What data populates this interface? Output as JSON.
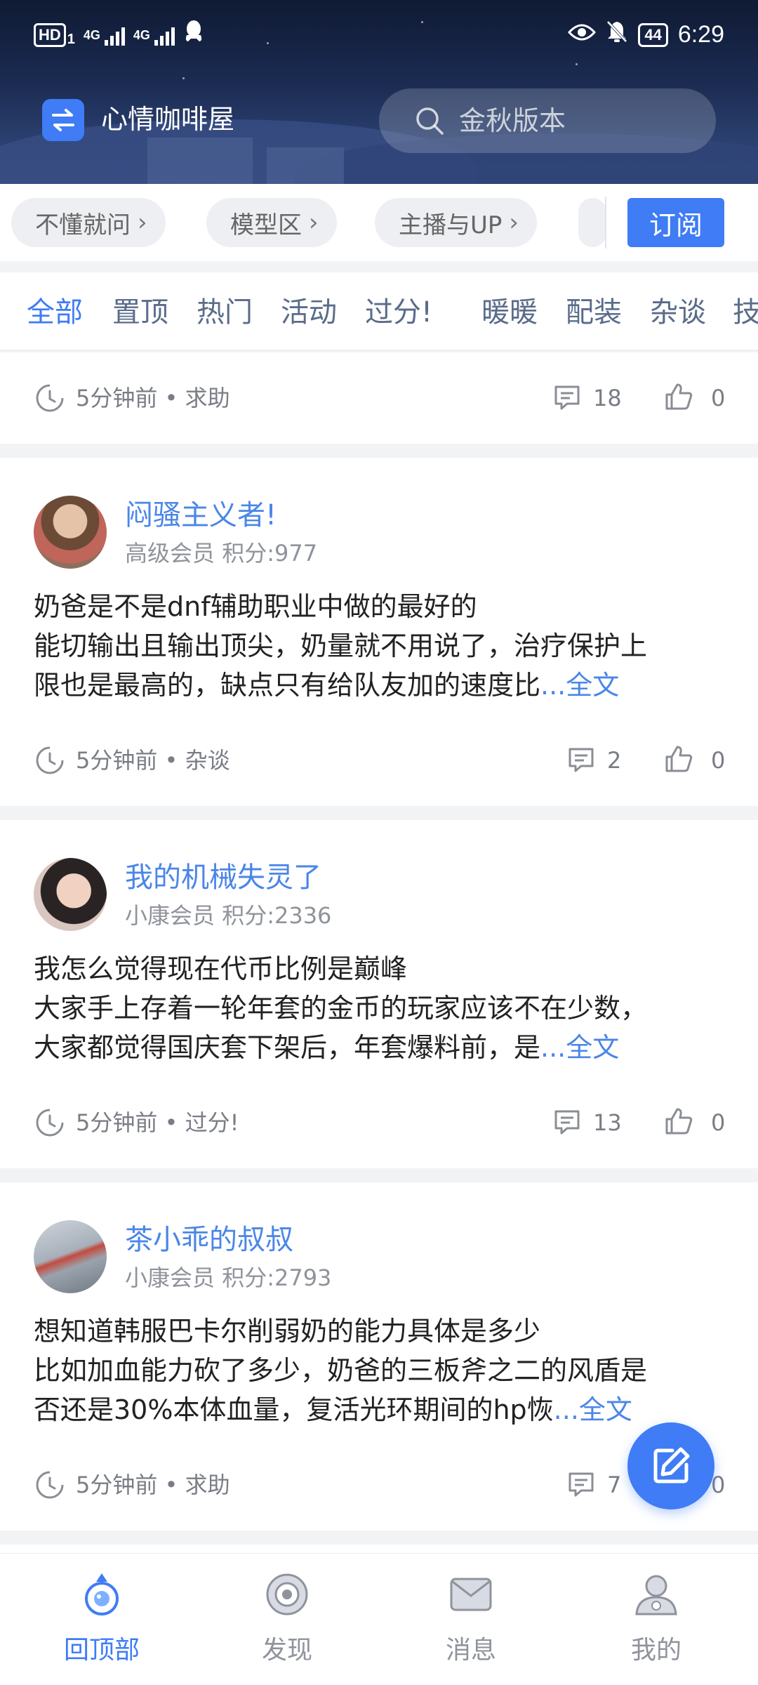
{
  "status_bar": {
    "hd": "HD",
    "sim_slot": "1",
    "net1": "4G",
    "net2": "4G",
    "battery": "44",
    "time": "6:29"
  },
  "header": {
    "title": "心情咖啡屋",
    "search_placeholder": "金秋版本"
  },
  "chips": [
    {
      "label": "不懂就问"
    },
    {
      "label": "模型区"
    },
    {
      "label": "主播与UP"
    }
  ],
  "subscribe_label": "订阅",
  "tabs": [
    {
      "label": "全部",
      "active": true
    },
    {
      "label": "置顶"
    },
    {
      "label": "热门"
    },
    {
      "label": "活动"
    },
    {
      "label": "过分!"
    },
    {
      "label": "暖暖"
    },
    {
      "label": "配装"
    },
    {
      "label": "杂谈"
    },
    {
      "label": "技"
    }
  ],
  "top_meta": {
    "time": "5分钟前",
    "category": "求助",
    "comments": "18",
    "likes": "0"
  },
  "posts": [
    {
      "user": "闷骚主义者!",
      "level": "高级会员",
      "score_label": "积分:977",
      "title": "奶爸是不是dnf辅助职业中做的最好的",
      "body_line1": "能切输出且输出顶尖，奶量就不用说了，治疗保护上",
      "body_line2": "限也是最高的，缺点只有给队友加的速度比",
      "more": "...全文",
      "time": "5分钟前",
      "category": "杂谈",
      "comments": "2",
      "likes": "0"
    },
    {
      "user": "我的机械失灵了",
      "level": "小康会员",
      "score_label": "积分:2336",
      "title": "我怎么觉得现在代币比例是巅峰",
      "body_line1": "大家手上存着一轮年套的金币的玩家应该不在少数，",
      "body_line2": "大家都觉得国庆套下架后，年套爆料前，是",
      "more": "...全文",
      "time": "5分钟前",
      "category": "过分!",
      "comments": "13",
      "likes": "0"
    },
    {
      "user": "茶小乖的叔叔",
      "level": "小康会员",
      "score_label": "积分:2793",
      "title": "想知道韩服巴卡尔削弱奶的能力具体是多少",
      "body_line1": "比如加血能力砍了多少，奶爸的三板斧之二的风盾是",
      "body_line2": "否还是30%本体血量，复活光环期间的hp恢",
      "more": "...全文",
      "time": "5分钟前",
      "category": "求助",
      "comments": "7",
      "likes": "0"
    }
  ],
  "bottom_nav": [
    {
      "label": "回顶部",
      "icon": "back-to-top-icon",
      "active": true
    },
    {
      "label": "发现",
      "icon": "discover-icon"
    },
    {
      "label": "消息",
      "icon": "message-icon"
    },
    {
      "label": "我的",
      "icon": "profile-icon"
    }
  ],
  "colors": {
    "accent": "#3f7cf5",
    "username": "#4a86e8",
    "tab_inactive": "#5a6c8a",
    "meta_text": "#7a7d85",
    "page_bg": "#f2f3f5"
  }
}
